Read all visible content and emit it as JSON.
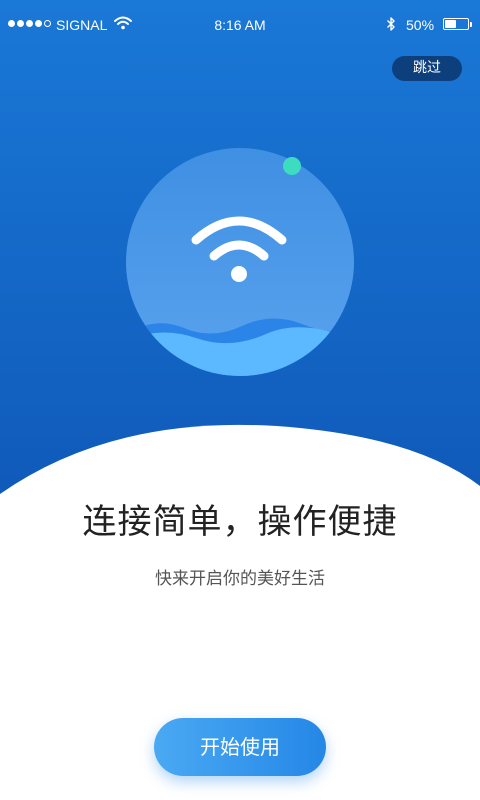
{
  "status_bar": {
    "carrier": "SIGNAL",
    "time": "8:16 AM",
    "battery_percent": "50%",
    "battery_level": 0.5,
    "signal_bars_filled": 4,
    "signal_bars_total": 5
  },
  "skip_button": {
    "label": "跳过"
  },
  "illustration": {
    "icon": "wifi-icon"
  },
  "main": {
    "title": "连接简单，操作便捷",
    "subtitle": "快来开启你的美好生活"
  },
  "start_button": {
    "label": "开始使用"
  },
  "colors": {
    "hero_top": "#1a78d6",
    "hero_bottom": "#0f58b8",
    "accent_dot": "#3ddbc0",
    "wave_light": "#5cb8ff",
    "wave_dark": "#2b85e8",
    "button_blue": "#2587e6"
  }
}
